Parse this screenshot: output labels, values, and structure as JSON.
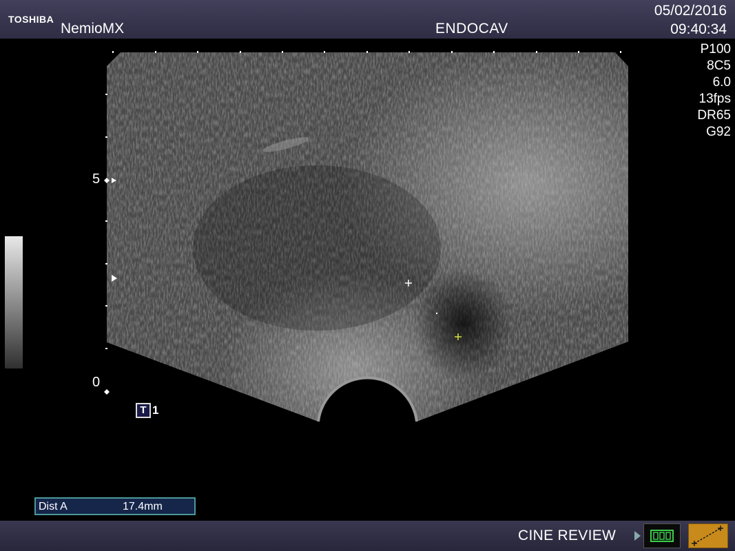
{
  "header": {
    "brand": "TOSHIBA",
    "model": "NemioMX",
    "probe_mode": "ENDOCAV",
    "date": "05/02/2016",
    "time": "09:40:34"
  },
  "parameters": [
    "P100",
    "8C5",
    "6.0",
    "13fps",
    "DR65",
    "G92"
  ],
  "depth_scale": {
    "top_label": "5",
    "bottom_label": "0"
  },
  "tgc": {
    "icon_letter": "T",
    "number": "1"
  },
  "measurement": {
    "label": "Dist A",
    "value": "17.4mm"
  },
  "footer": {
    "cine_label": "CINE REVIEW",
    "cine_icon": "film-strip-icon",
    "caliper_icon": "caliper-measure-icon"
  },
  "colors": {
    "bar_bg": "#34324a",
    "caliper_button": "#c88a1a",
    "measure_border": "#4a9a9a",
    "cine_icon": "#39d04a"
  }
}
